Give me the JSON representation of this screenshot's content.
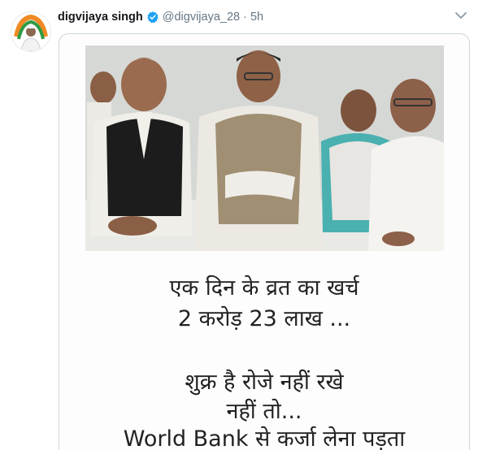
{
  "tweet": {
    "author_name": "digvijaya singh",
    "verified": true,
    "handle": "@digvijaya_28",
    "separator": "·",
    "timestamp": "5h"
  },
  "media": {
    "caption_lines": [
      "एक दिन के व्रत का खर्च",
      "2 करोड़ 23 लाख ...",
      "शुक्र है रोजे नहीं रखे",
      "नहीं तो...",
      "World Bank से कर्जा लेना पड़ता"
    ]
  },
  "colors": {
    "name": "#14171a",
    "secondary": "#657786",
    "verified": "#1da1f2",
    "border": "#ccd6dd"
  },
  "icons": [
    "verified-badge-icon",
    "chevron-down-icon"
  ]
}
